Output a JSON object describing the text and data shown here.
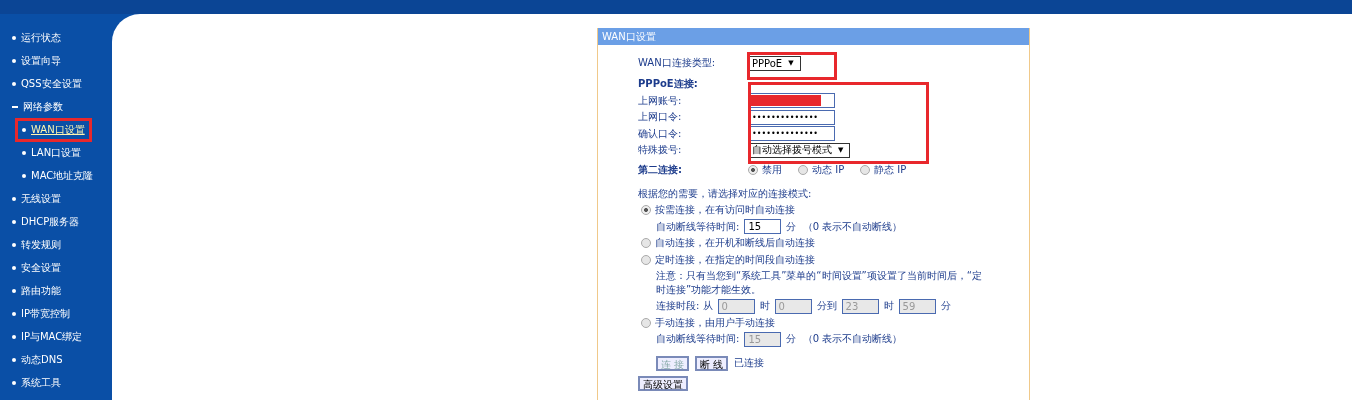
{
  "sidebar": {
    "items": [
      {
        "label": "运行状态",
        "selected": false
      },
      {
        "label": "设置向导",
        "selected": false
      },
      {
        "label": "QSS安全设置",
        "selected": false
      },
      {
        "label": "网络参数",
        "selected": false,
        "expanded": true,
        "children": [
          {
            "label": "WAN口设置",
            "selected": true
          },
          {
            "label": "LAN口设置",
            "selected": false
          },
          {
            "label": "MAC地址克隆",
            "selected": false
          }
        ]
      },
      {
        "label": "无线设置",
        "selected": false
      },
      {
        "label": "DHCP服务器",
        "selected": false
      },
      {
        "label": "转发规则",
        "selected": false
      },
      {
        "label": "安全设置",
        "selected": false
      },
      {
        "label": "路由功能",
        "selected": false
      },
      {
        "label": "IP带宽控制",
        "selected": false
      },
      {
        "label": "IP与MAC绑定",
        "selected": false
      },
      {
        "label": "动态DNS",
        "selected": false
      },
      {
        "label": "系统工具",
        "selected": false
      }
    ]
  },
  "panel": {
    "title": "WAN口设置",
    "connection_type": {
      "label": "WAN口连接类型:",
      "value": "PPPoE",
      "arrow": "▼"
    },
    "section_label": "PPPoE连接:",
    "fields": [
      {
        "label": "上网账号:",
        "kind": "redacted"
      },
      {
        "label": "上网口令:",
        "kind": "password",
        "value": "••••••••••••••"
      },
      {
        "label": "确认口令:",
        "kind": "password",
        "value": "••••••••••••••"
      },
      {
        "label": "特殊拨号:",
        "kind": "select",
        "value": "自动选择拨号模式",
        "arrow": "▼"
      }
    ],
    "second_connection": {
      "label": "第二连接:",
      "options": [
        {
          "label": "禁用",
          "selected": true
        },
        {
          "label": "动态 IP",
          "selected": false
        },
        {
          "label": "静态 IP",
          "selected": false
        }
      ]
    },
    "mode_prompt": "根据您的需要，请选择对应的连接模式:",
    "modes": [
      {
        "label": "按需连接，在有访问时自动连接",
        "selected": true,
        "detail": {
          "kind": "wait",
          "label": "自动断线等待时间:",
          "value": "15",
          "unit": "分",
          "hint": "（0 表示不自动断线）",
          "disabled": false
        }
      },
      {
        "label": "自动连接，在开机和断线后自动连接",
        "selected": false
      },
      {
        "label": "定时连接，在指定的时间段自动连接",
        "selected": false,
        "detail": {
          "kind": "schedule",
          "note": "注意：只有当您到“系统工具”菜单的“时间设置”项设置了当前时间后，“定时连接”功能才能生效。",
          "label": "连接时段:",
          "from": "从",
          "parts": [
            {
              "value": "0",
              "unit": "时"
            },
            {
              "value": "0",
              "unit": "分到"
            },
            {
              "value": "23",
              "unit": "时"
            },
            {
              "value": "59",
              "unit": "分"
            }
          ],
          "disabled": true
        }
      },
      {
        "label": "手动连接，由用户手动连接",
        "selected": false,
        "detail": {
          "kind": "wait",
          "label": "自动断线等待时间:",
          "value": "15",
          "unit": "分",
          "hint": "（0 表示不自动断线）",
          "disabled": true
        }
      }
    ],
    "buttons": [
      {
        "label": "连 接",
        "disabled": true
      },
      {
        "label": "断 线",
        "disabled": false
      }
    ],
    "status": "已连接",
    "advanced_button": "高级设置"
  }
}
